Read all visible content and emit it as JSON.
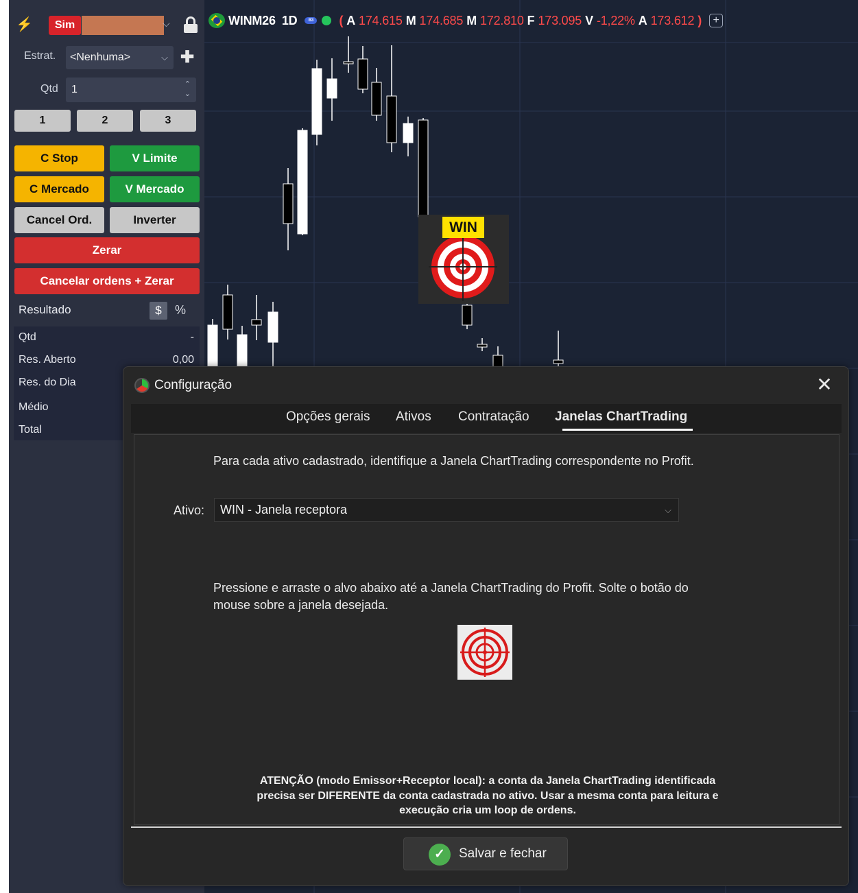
{
  "chart": {
    "ticker": "WINM26",
    "timeframe": "1D",
    "quote": {
      "open_paren": "(",
      "a_label": "A",
      "a_value": "174.615",
      "m1_label": "M",
      "m1_value": "174.685",
      "m2_label": "M",
      "m2_value": "172.810",
      "f_label": "F",
      "f_value": "173.095",
      "v_label": "V",
      "v_value": "-1,22%",
      "a2_label": "A",
      "a2_value": "173.612",
      "close_paren": ")"
    },
    "add_symbol": "+",
    "target_label": "WIN",
    "colors": {
      "background": "#1b2334",
      "bull": "#ffffff",
      "bear": "#000000",
      "negative_quote": "#ff4a4a"
    }
  },
  "panel": {
    "account_mode": "Sim",
    "strategy_label": "Estrat.",
    "strategy_value": "<Nenhuma>",
    "qty_label": "Qtd",
    "qty_value": "1",
    "quick_qty": [
      "1",
      "2",
      "3"
    ],
    "buttons": {
      "c_stop": "C Stop",
      "v_limite": "V Limite",
      "c_mercado": "C Mercado",
      "v_mercado": "V Mercado",
      "cancel_ord": "Cancel Ord.",
      "inverter": "Inverter",
      "zerar": "Zerar",
      "cancelar_zerar": "Cancelar ordens + Zerar"
    },
    "resultado_label": "Resultado",
    "currency_toggle": "$",
    "percent_toggle": "%",
    "stats": [
      {
        "label": "Qtd",
        "value": "-"
      },
      {
        "label": "Res. Aberto",
        "value": "0,00"
      },
      {
        "label": "Res. do Dia",
        "value": ""
      },
      {
        "label": "Médio",
        "value": ""
      },
      {
        "label": "Total",
        "value": ""
      }
    ]
  },
  "dialog": {
    "title": "Configuração",
    "tabs": [
      "Opções gerais",
      "Ativos",
      "Contratação",
      "Janelas ChartTrading"
    ],
    "active_tab": "Janelas ChartTrading",
    "intro": "Para cada ativo cadastrado, identifique a Janela ChartTrading correspondente no Profit.",
    "ativo_label": "Ativo:",
    "ativo_value": "WIN - Janela receptora",
    "drag_line1": "Pressione e arraste o alvo abaixo até a Janela ChartTrading do Profit. Solte o botão do",
    "drag_line2": "mouse sobre a janela desejada.",
    "warning_line1": "ATENÇÃO (modo Emissor+Receptor local): a conta da Janela ChartTrading identificada",
    "warning_line2": "precisa ser DIFERENTE da conta cadastrada no ativo. Usar a mesma conta para leitura e",
    "warning_line3": "execução cria um loop de ordens.",
    "save_button": "Salvar e fechar"
  }
}
